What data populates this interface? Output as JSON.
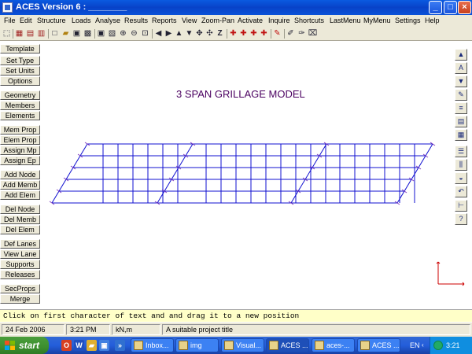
{
  "window": {
    "title": "ACES Version 6 : ________"
  },
  "menu": [
    "File",
    "Edit",
    "Structure",
    "Loads",
    "Analyse",
    "Results",
    "Reports",
    "View",
    "Zoom-Pan",
    "Activate",
    "Inquire",
    "Shortcuts",
    "LastMenu",
    "MyMenu",
    "Settings",
    "Help"
  ],
  "left_buttons": [
    "Template",
    "Set Type",
    "Set Units",
    "Options",
    "Geometry",
    "Members",
    "Elements",
    "Mem Prop",
    "Elem Prop",
    "Assign Mp",
    "Assign Ep",
    "Add Node",
    "Add Memb",
    "Add Elem",
    "Del Node",
    "Del Memb",
    "Del Elem",
    "Def Lanes",
    "View Lane",
    "Supports",
    "Releases",
    "SecProps",
    "Merge"
  ],
  "model_title": "3 SPAN GRILLAGE MODEL",
  "message": "Click on first character of text and and drag it to a new position",
  "status": {
    "date": "24 Feb 2006",
    "time": "3:21 PM",
    "units": "kN,m",
    "project": "A suitable project title"
  },
  "taskbar": {
    "start_label": "start",
    "tasks": [
      "Inbox...",
      "img",
      "Visual...",
      "ACES ...",
      "aces-...",
      "ACES ..."
    ],
    "language": "EN",
    "clock": "3:21 PM"
  },
  "icons": {
    "toolbar": [
      "pointer-icon",
      "tile-icon",
      "zoom-window-icon",
      "grid-icon",
      "new-file-icon",
      "open-folder-icon",
      "save-icon",
      "print-icon",
      "view-icon",
      "redraw-icon",
      "zoom-in-icon",
      "zoom-out-icon",
      "fit-icon",
      "arrow-left-icon",
      "arrow-right-icon",
      "arrow-up-icon",
      "arrow-down-icon",
      "pan-icon",
      "rotate-icon",
      "z-icon",
      "node-icon",
      "member-icon",
      "element-icon",
      "support-icon",
      "select-icon",
      "measure-icon",
      "text-icon",
      "erase-icon"
    ],
    "right_tools": [
      "arrow-up-icon",
      "text-edit-icon",
      "move-down-icon",
      "pen-icon",
      "list-icon",
      "window-icon",
      "table-icon",
      "beam-icon",
      "column-icon",
      "load-icon",
      "undo-icon",
      "dimension-icon",
      "help-icon"
    ]
  },
  "colors": {
    "grid": "#1010d0",
    "title_text": "#4a0060",
    "axis": "#cc0000",
    "message_bg": "#ffffc8"
  }
}
